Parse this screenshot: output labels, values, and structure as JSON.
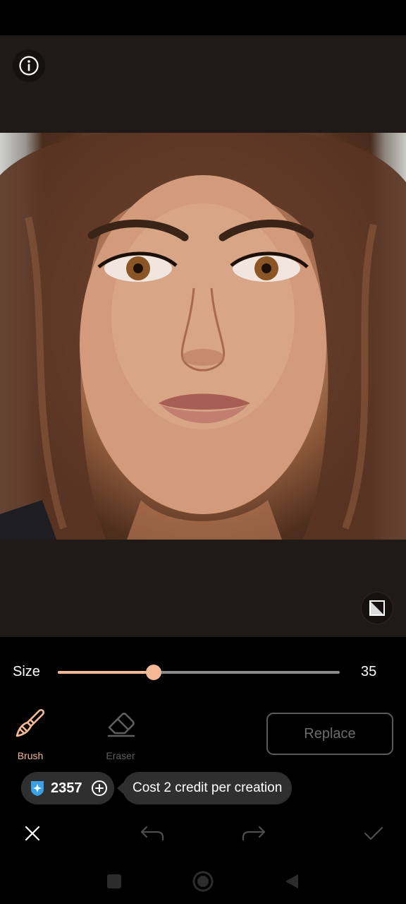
{
  "canvas": {
    "info_icon": "info-icon",
    "compare_icon": "compare-icon",
    "photo_subject": "portrait photo"
  },
  "size": {
    "label": "Size",
    "value": "35",
    "fraction": 0.34,
    "accent_color": "#f6b996"
  },
  "tools": {
    "brush_label": "Brush",
    "eraser_label": "Eraser",
    "selected": "brush"
  },
  "replace_label": "Replace",
  "credits": {
    "count": "2357",
    "cost_text": "Cost 2 credit per creation"
  },
  "actions": {
    "close_icon": "close-icon",
    "undo_icon": "undo-icon",
    "redo_icon": "redo-icon",
    "confirm_icon": "check-icon"
  },
  "navigation": {
    "recents_icon": "square-icon",
    "home_icon": "circle-icon",
    "back_icon": "triangle-back-icon"
  }
}
